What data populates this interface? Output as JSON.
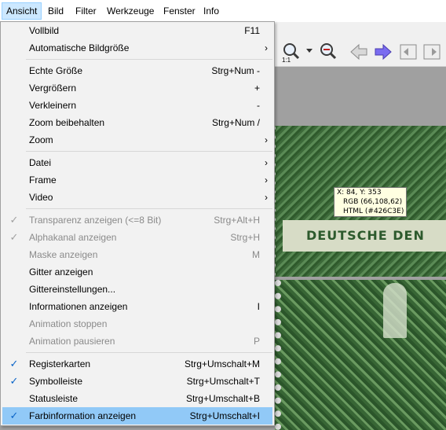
{
  "menubar": {
    "items": [
      "Ansicht",
      "Bild",
      "Filter",
      "Werkzeuge",
      "Fenster",
      "Info"
    ]
  },
  "menu": {
    "rows": [
      {
        "label": "Vollbild",
        "shortcut": "F11"
      },
      {
        "label": "Automatische Bildgröße",
        "submenu": true
      },
      {
        "label": "Echte Größe",
        "shortcut": "Strg+Num -"
      },
      {
        "label": "Vergrößern",
        "shortcut": "+"
      },
      {
        "label": "Verkleinern",
        "shortcut": "-"
      },
      {
        "label": "Zoom beibehalten",
        "shortcut": "Strg+Num /"
      },
      {
        "label": "Zoom",
        "submenu": true
      },
      {
        "label": "Datei",
        "submenu": true
      },
      {
        "label": "Frame",
        "submenu": true
      },
      {
        "label": "Video",
        "submenu": true
      },
      {
        "label": "Transparenz anzeigen (<=8 Bit)",
        "shortcut": "Strg+Alt+H",
        "checked": true,
        "disabled": true
      },
      {
        "label": "Alphakanal anzeigen",
        "shortcut": "Strg+H",
        "checked": true,
        "disabled": true
      },
      {
        "label": "Maske anzeigen",
        "shortcut": "M",
        "disabled": true
      },
      {
        "label": "Gitter anzeigen"
      },
      {
        "label": "Gittereinstellungen..."
      },
      {
        "label": "Informationen anzeigen",
        "shortcut": "I"
      },
      {
        "label": "Animation stoppen",
        "disabled": true
      },
      {
        "label": "Animation pausieren",
        "shortcut": "P",
        "disabled": true
      },
      {
        "label": "Registerkarten",
        "shortcut": "Strg+Umschalt+M",
        "checked": true
      },
      {
        "label": "Symbolleiste",
        "shortcut": "Strg+Umschalt+T",
        "checked": true
      },
      {
        "label": "Statusleiste",
        "shortcut": "Strg+Umschalt+B"
      },
      {
        "label": "Farbinformation anzeigen",
        "shortcut": "Strg+Umschalt+I",
        "checked": true,
        "highlighted": true
      }
    ],
    "submenu_arrow": "›",
    "check_mark": "✓"
  },
  "tooltip": {
    "coords": "X: 84, Y: 353",
    "rgb": "RGB (66,108,62)",
    "html": "HTML (#426C3E)"
  },
  "stamp": {
    "text": "DEUTSCHE DEN"
  },
  "toolbar": {
    "zoom_badge": "1:1"
  },
  "colors": {
    "highlight": "#91c9f7",
    "pixel_color": "#426C3E",
    "check": "#0a64c8"
  }
}
